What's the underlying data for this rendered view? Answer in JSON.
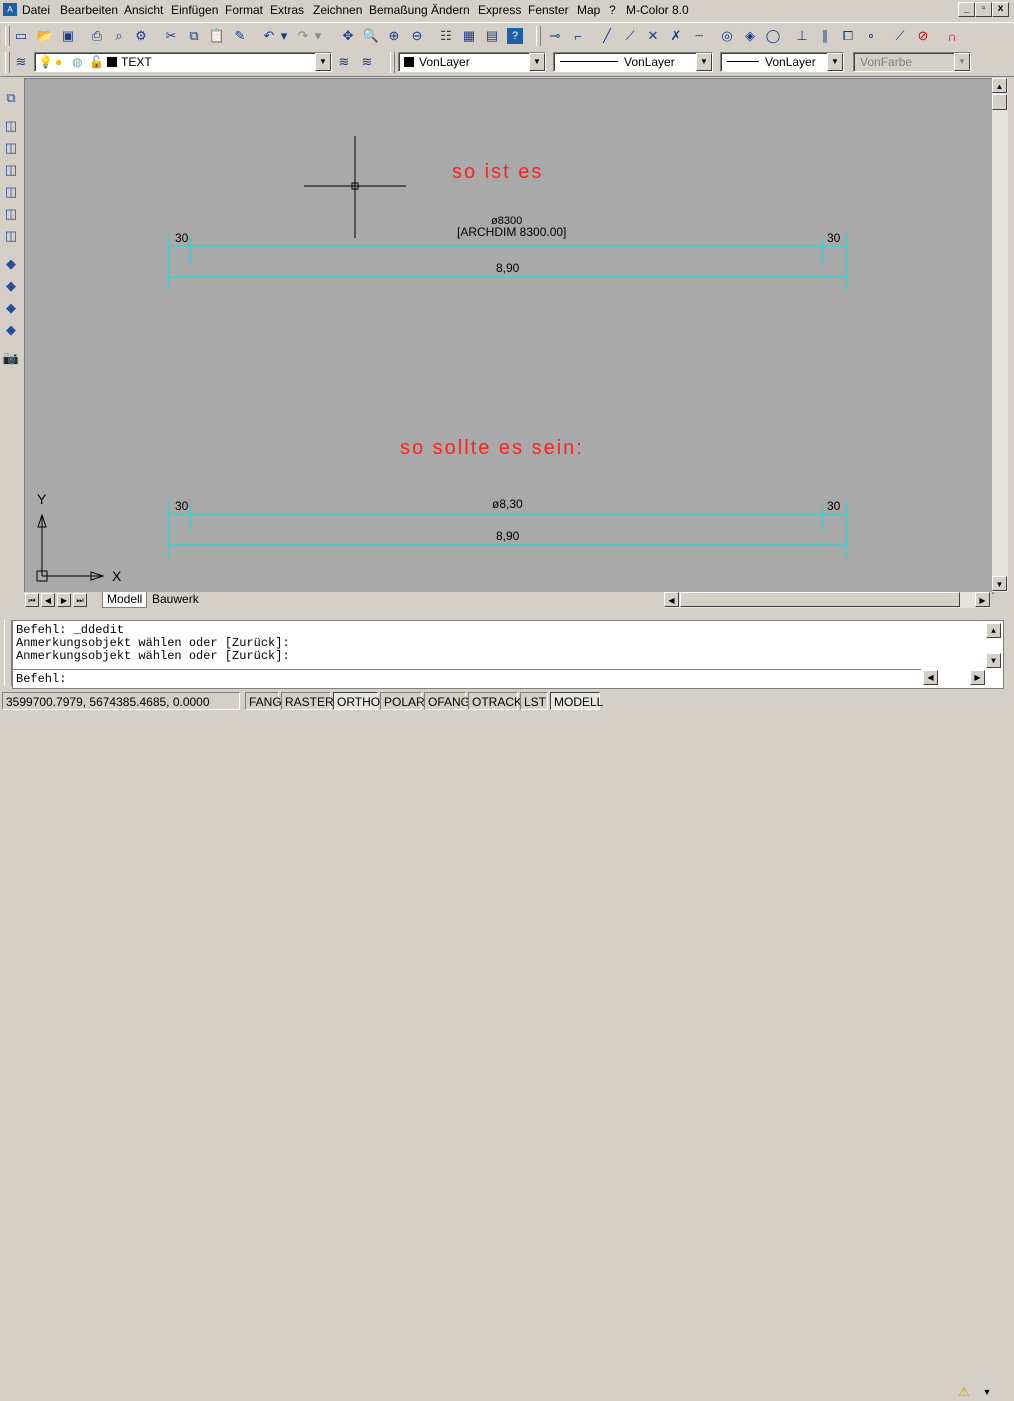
{
  "menubar": {
    "items": [
      "Datei",
      "Bearbeiten",
      "Ansicht",
      "Einfügen",
      "Format",
      "Extras",
      "Zeichnen",
      "Bemaßung",
      "Ändern",
      "Express",
      "Fenster",
      "Map",
      "?",
      "M-Color 8.0"
    ],
    "win_minimize": "_",
    "win_restore": "▫",
    "win_close": "x"
  },
  "layer_toolbar": {
    "layer_name": "TEXT",
    "color_combo": "VonLayer",
    "linetype_combo": "VonLayer",
    "lineweight_combo": "VonLayer",
    "plotstyle_combo": "VonFarbe"
  },
  "drawing": {
    "label_is": "so  ist  es",
    "label_should": "so  sollte  es  sein:",
    "dim1_overlap_top": "ø8300",
    "dim1_archdim": "[ARCHDIM 8300.00]",
    "dim1_left": "30",
    "dim1_right": "30",
    "dim2_total": "8,90",
    "dim3_value": "ø8,30",
    "dim3_left": "30",
    "dim3_right": "30",
    "dim4_total": "8,90",
    "ucs_x": "X",
    "ucs_y": "Y",
    "colors": {
      "background": "#a9a9a9",
      "dimension": "#00e5e5",
      "text_red": "#ff2020"
    }
  },
  "tabs": {
    "model": "Modell",
    "layout": "Bauwerk"
  },
  "command": {
    "lines": [
      "Befehl: _ddedit",
      "Anmerkungsobjekt wählen oder [Zurück]:",
      "Anmerkungsobjekt wählen oder [Zurück]:"
    ],
    "prompt": "Befehl:"
  },
  "status": {
    "coords": "3599700.7979, 5674385.4685, 0.0000",
    "toggles": [
      "FANG",
      "RASTER",
      "ORTHO",
      "POLAR",
      "OFANG",
      "OTRACK",
      "LST",
      "MODELL"
    ]
  }
}
